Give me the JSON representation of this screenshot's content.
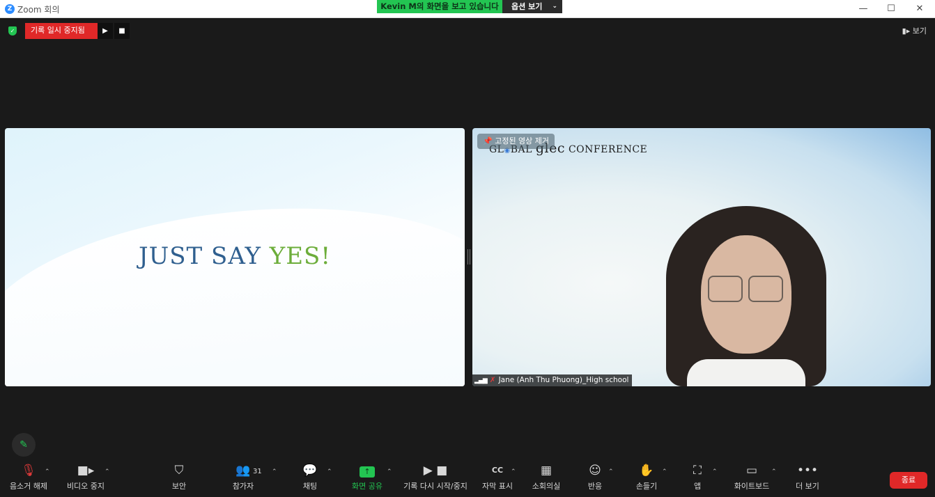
{
  "window": {
    "app_name": "Zoom 회의",
    "logo_letter": "Z",
    "minimize": "—",
    "maximize": "☐",
    "close": "✕"
  },
  "share_banner": {
    "text": "Kevin M의 화면을 보고 있습니다",
    "options_label": "옵션 보기",
    "chevron": "⌄"
  },
  "recording": {
    "status": "기록 일시 중지됨",
    "play": "▶",
    "stop": "■"
  },
  "view": {
    "label": "보기",
    "icon": "▮▸"
  },
  "slide": {
    "text_part1": "JUST SAY ",
    "text_part2": "YES!"
  },
  "video": {
    "unpin_label": "고정된 영상 제거",
    "logo_part1": "GL",
    "logo_part2": "◉",
    "logo_part3": "BAL ",
    "logo_part4": "glec",
    "logo_part5": " CONFERENCE",
    "participant_name": "Jane (Anh Thu Phuong)_High school",
    "signal_icon": "▂▄▆",
    "mic_icon": "✗"
  },
  "toolbar": {
    "items": [
      {
        "label": "음소거 해제",
        "icon": "🎙"
      },
      {
        "label": "비디오 중지",
        "icon": "■▸"
      },
      {
        "label": "보안",
        "icon": "⛉"
      },
      {
        "label": "참가자",
        "icon": "👥",
        "count": "31"
      },
      {
        "label": "채팅",
        "icon": "💬"
      },
      {
        "label": "화면 공유",
        "icon": "↑"
      },
      {
        "label": "기록 다시 시작/중지",
        "icon": "▶ ■"
      },
      {
        "label": "자막 표시",
        "icon": "CC"
      },
      {
        "label": "소회의실",
        "icon": "▦"
      },
      {
        "label": "반응",
        "icon": "☺"
      },
      {
        "label": "손들기",
        "icon": "✋"
      },
      {
        "label": "앱",
        "icon": "⛶"
      },
      {
        "label": "화이트보드",
        "icon": "▭"
      },
      {
        "label": "더 보기",
        "icon": "•••"
      }
    ],
    "caret": "⌃",
    "end_label": "종료",
    "annotate_icon": "✎"
  },
  "colors": {
    "accent_green": "#23c552",
    "danger_red": "#e02828",
    "background": "#1a1a1a"
  }
}
